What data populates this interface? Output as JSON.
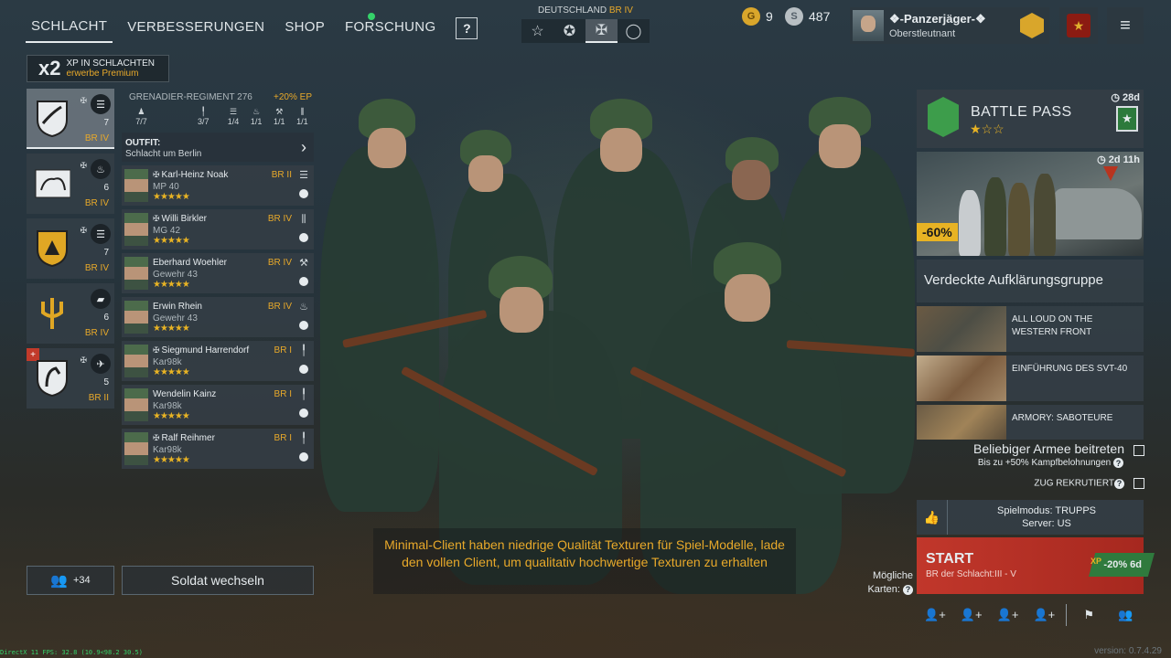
{
  "nav": {
    "tabs": [
      {
        "label": "SCHLACHT",
        "active": true
      },
      {
        "label": "VERBESSERUNGEN"
      },
      {
        "label": "SHOP"
      },
      {
        "label": "FORSCHUNG"
      }
    ],
    "help": "?"
  },
  "nation": {
    "name": "DEUTSCHLAND",
    "br": "BR IV"
  },
  "currency": {
    "gold": "9",
    "silver": "487"
  },
  "profile": {
    "name": "❖-Panzerjäger-❖",
    "rank": "Oberstleutnant"
  },
  "xp_bonus": {
    "mult": "x2",
    "line1": "XP IN SCHLACHTEN",
    "line2": "erwerbe Premium"
  },
  "squads": [
    {
      "count": "7",
      "br": "BR IV"
    },
    {
      "count": "6",
      "br": "BR IV"
    },
    {
      "count": "7",
      "br": "BR IV"
    },
    {
      "count": "6",
      "br": "BR IV"
    },
    {
      "count": "5",
      "br": "BR II"
    }
  ],
  "details": {
    "regiment": "GRENADIER-REGIMENT 276",
    "ep_bonus": "+20% EP",
    "stats": [
      "7/7",
      "3/7",
      "1/4",
      "1/1",
      "1/1",
      "1/1"
    ],
    "outfit_title": "OUTFIT:",
    "outfit_name": "Schlacht um Berlin",
    "soldiers": [
      {
        "name": "Karl-Heinz Noak",
        "weapon": "MP 40",
        "br": "BR II",
        "stars": "★★★★★"
      },
      {
        "name": "Willi Birkler",
        "weapon": "MG 42",
        "br": "BR IV",
        "stars": "★★★★★"
      },
      {
        "name": "Eberhard Woehler",
        "weapon": "Gewehr 43",
        "br": "BR IV",
        "stars": "★★★★★"
      },
      {
        "name": "Erwin Rhein",
        "weapon": "Gewehr 43",
        "br": "BR IV",
        "stars": "★★★★★"
      },
      {
        "name": "Siegmund Harrendorf",
        "weapon": "Kar98k",
        "br": "BR I",
        "stars": "★★★★★"
      },
      {
        "name": "Wendelin Kainz",
        "weapon": "Kar98k",
        "br": "BR I",
        "stars": "★★★★★"
      },
      {
        "name": "Ralf Reihmer",
        "weapon": "Kar98k",
        "br": "BR I",
        "stars": "★★★★★"
      }
    ]
  },
  "friends": {
    "count": "+34"
  },
  "switch_soldier": "Soldat wechseln",
  "notice": "Minimal-Client haben niedrige Qualität Texturen für Spiel-Modelle, lade den vollen Client, um qualitativ hochwertige Texturen zu erhalten",
  "battlepass": {
    "title": "BATTLE PASS",
    "time": "28d",
    "stars": "★☆☆"
  },
  "promo": {
    "time": "2d 11h",
    "discount": "-60%",
    "title": "Verdeckte Aufklärungsgruppe"
  },
  "news": [
    {
      "title": "ALL LOUD ON THE WESTERN FRONT"
    },
    {
      "title": "EINFÜHRUNG DES SVT-40"
    },
    {
      "title": "ARMORY: SABOTEURE"
    }
  ],
  "options": {
    "join_any": "Beliebiger Armee beitreten",
    "join_any_sub": "Bis zu +50% Kampfbelohnungen",
    "recruit": "ZUG REKRUTIERT"
  },
  "mode": {
    "line1": "Spielmodus: TRUPPS",
    "line2": "Server: US"
  },
  "start": {
    "label": "START",
    "sub": "BR der Schlacht:III - V",
    "xp": "-20% 6d",
    "xp_icon": "XP"
  },
  "maps": {
    "line1": "Mögliche",
    "line2": "Karten:"
  },
  "fps": "DirectX 11 FPS: 32.8 (10.9<98.2 30.5)",
  "version": "version: 0.7.4.29",
  "colors": {
    "accent": "#e8a92a",
    "start": "#c1372b",
    "xpgreen": "#2f7a3d"
  }
}
